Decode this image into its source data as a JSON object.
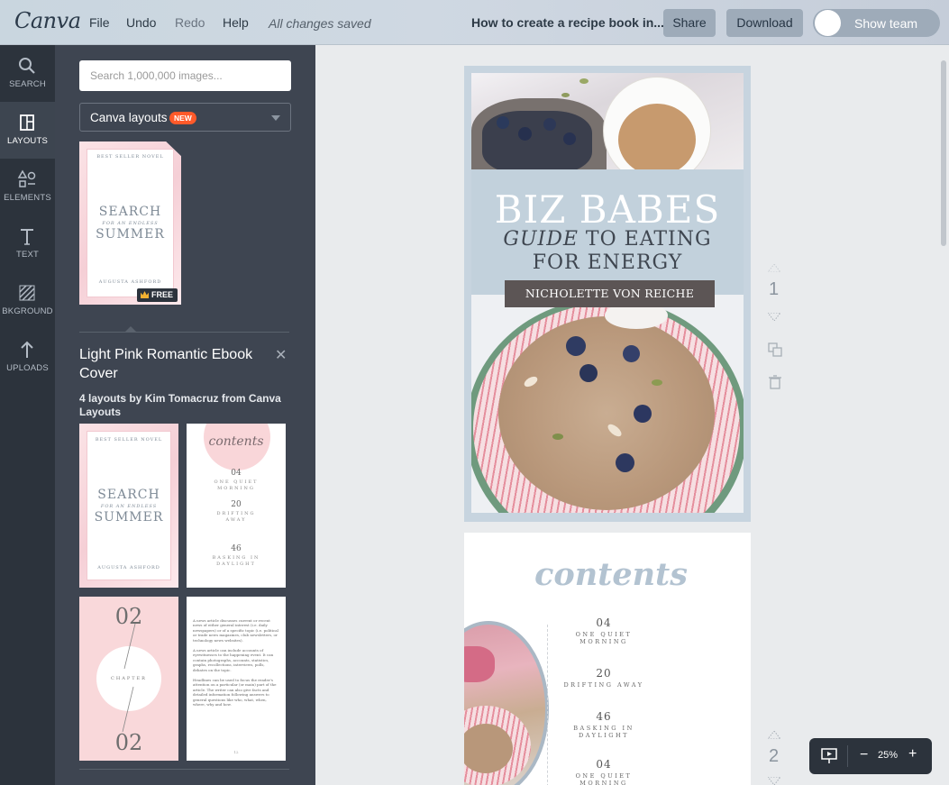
{
  "topbar": {
    "logo": "Canva",
    "menu": [
      "File",
      "Undo",
      "Redo",
      "Help"
    ],
    "saved_status": "All changes saved",
    "document_title": "How to create a recipe book in...",
    "share_label": "Share",
    "download_label": "Download",
    "show_team_label": "Show team"
  },
  "rail": [
    {
      "label": "SEARCH",
      "icon": "search-icon"
    },
    {
      "label": "LAYOUTS",
      "icon": "layouts-icon",
      "active": true
    },
    {
      "label": "ELEMENTS",
      "icon": "elements-icon"
    },
    {
      "label": "TEXT",
      "icon": "text-icon"
    },
    {
      "label": "BKGROUND",
      "icon": "background-icon"
    },
    {
      "label": "UPLOADS",
      "icon": "upload-arrow-icon"
    }
  ],
  "panel": {
    "search_placeholder": "Search 1,000,000 images...",
    "select_value": "Canva layouts",
    "new_badge": "NEW",
    "free_badge": "FREE",
    "selected_group_title": "Light Pink Romantic Ebook Cover",
    "selected_group_subtitle": "4 layouts by Kim Tomacruz from Canva Layouts",
    "thumb_cover": {
      "kicker": "BEST SELLER NOVEL",
      "line1": "SEARCH",
      "line2": "FOR AN ENDLESS",
      "line3": "SUMMER",
      "author": "AUGUSTA ASHFORD"
    },
    "thumb_contents": {
      "title": "contents",
      "entries": [
        {
          "num": "04",
          "text": "ONE QUIET MORNING"
        },
        {
          "num": "20",
          "text": "DRIFTING AWAY"
        },
        {
          "num": "46",
          "text": "BASKING IN DAYLIGHT"
        }
      ]
    },
    "thumb_chapter": {
      "top": "02",
      "mid": "CHAPTER",
      "bottom": "02"
    },
    "thumb_article": [
      "A news article discusses current or recent news of either general interest (i.e. daily newspapers) or of a specific topic (i.e. political or trade news magazines, club newsletters, or technology news websites).",
      "A news article can include accounts of eyewitnesses to the happening event. It can contain photographs, accounts, statistics, graphs, recollections, interviews, polls, debates on the topic.",
      "Headlines can be used to focus the reader's attention on a particular (or main) part of the article. The writer can also give facts and detailed information following answers to general questions like who, what, when, where, why and how."
    ],
    "thumb_article_page": "12"
  },
  "canvas": {
    "cover": {
      "title1": "BIZ BABES",
      "title2_italic": "GUIDE",
      "title2_rest": " TO EATING",
      "title3": "FOR ENERGY",
      "author": "NICHOLETTE VON REICHE"
    },
    "contents_page": {
      "title": "contents",
      "entries": [
        {
          "num": "04",
          "text": "ONE QUIET MORNING"
        },
        {
          "num": "20",
          "text": "DRIFTING AWAY"
        },
        {
          "num": "46",
          "text": "BASKING IN DAYLIGHT"
        },
        {
          "num": "04",
          "text": "ONE QUIET MORNING"
        }
      ]
    },
    "page_numbers": [
      "1",
      "2"
    ],
    "zoom": "25%"
  },
  "colors": {
    "rail_bg": "#2c333c",
    "panel_bg": "#3e4551",
    "topbar_bg": "#c9d6df",
    "accent_new": "#ff5a2a",
    "cover_band": "#c2d1dc",
    "author_bar": "#5c5555"
  }
}
